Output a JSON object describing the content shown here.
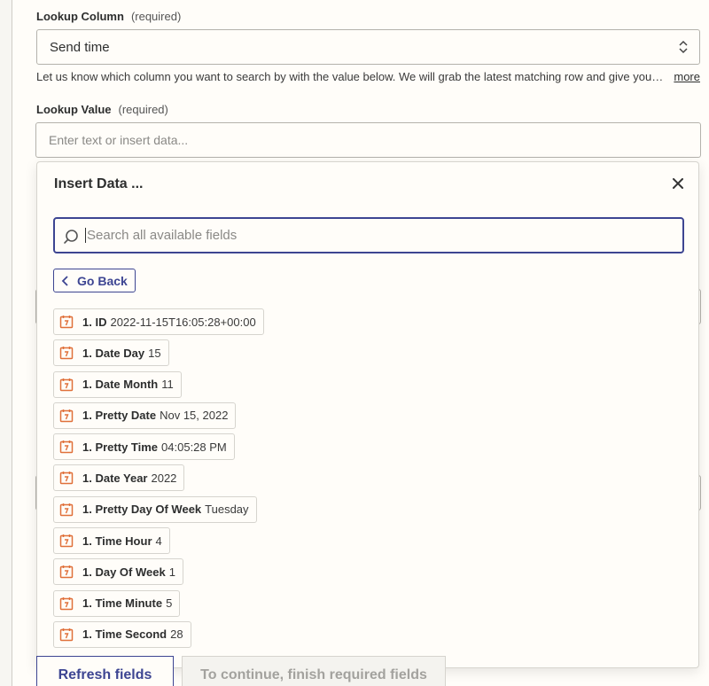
{
  "lookup_column": {
    "label": "Lookup Column",
    "required": "(required)",
    "value": "Send time",
    "help": "Let us know which column you want to search by with the value below. We will grab the latest matching row and give you all its data.",
    "more": "more"
  },
  "lookup_value": {
    "label": "Lookup Value",
    "required": "(required)",
    "placeholder": "Enter text or insert data..."
  },
  "popover": {
    "title": "Insert Data ...",
    "search_placeholder": "Search all available fields",
    "back_label": "Go Back",
    "items": [
      {
        "key": "1. ID",
        "value": "2022-11-15T16:05:28+00:00"
      },
      {
        "key": "1. Date Day",
        "value": "15"
      },
      {
        "key": "1. Date Month",
        "value": "11"
      },
      {
        "key": "1. Pretty Date",
        "value": "Nov 15, 2022"
      },
      {
        "key": "1. Pretty Time",
        "value": "04:05:28 PM"
      },
      {
        "key": "1. Date Year",
        "value": "2022"
      },
      {
        "key": "1. Pretty Day Of Week",
        "value": "Tuesday"
      },
      {
        "key": "1. Time Hour",
        "value": "4"
      },
      {
        "key": "1. Day Of Week",
        "value": "1"
      },
      {
        "key": "1. Time Minute",
        "value": "5"
      },
      {
        "key": "1. Time Second",
        "value": "28"
      }
    ]
  },
  "footer": {
    "refresh_label": "Refresh fields",
    "continue_label": "To continue, finish required fields"
  },
  "colors": {
    "accent": "#3d4592",
    "icon_orange": "#e0703a",
    "background": "#fffdf9"
  },
  "icons": {
    "item_icon": "calendar-icon",
    "search": "search-icon",
    "close": "close-icon",
    "back": "chevron-left-icon",
    "select": "chevron-up-down-icon"
  }
}
